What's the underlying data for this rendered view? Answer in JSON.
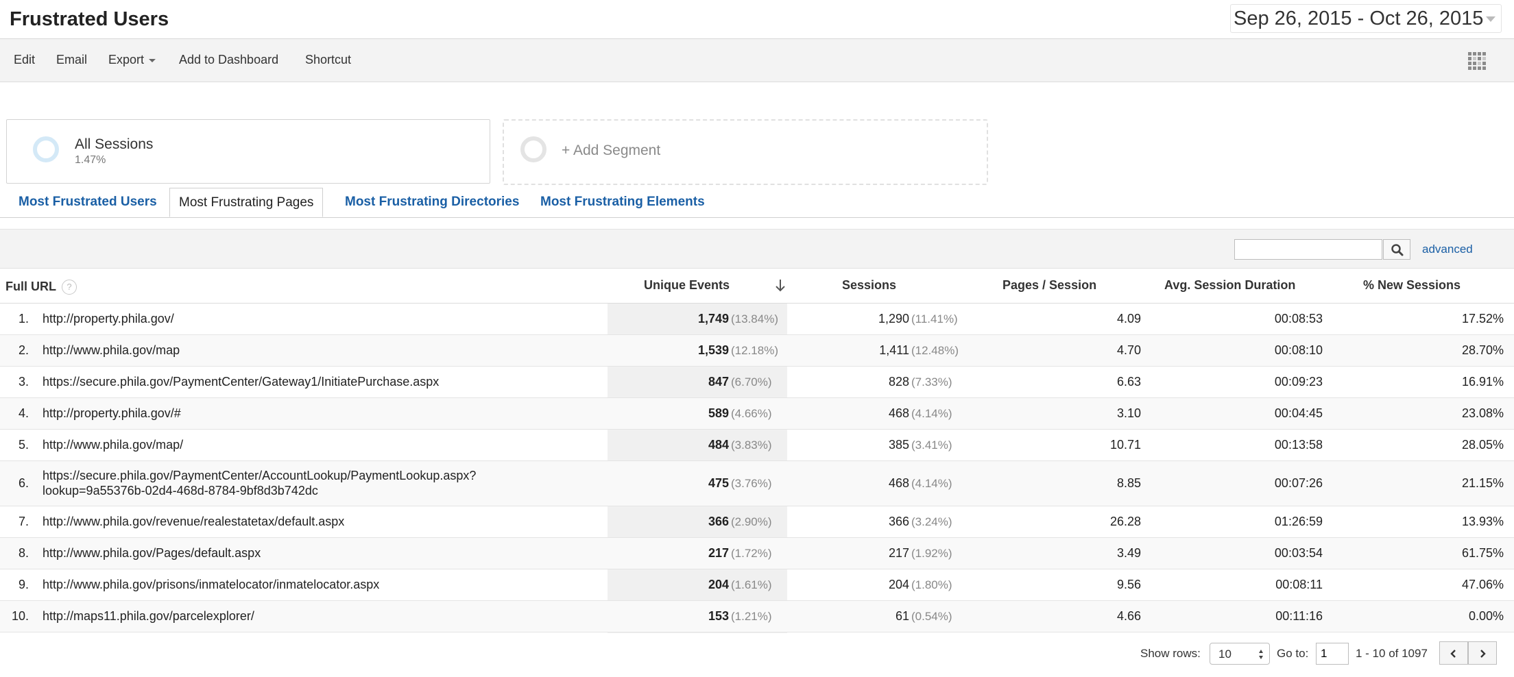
{
  "header": {
    "title": "Frustrated Users",
    "date_range": "Sep 26, 2015 - Oct 26, 2015"
  },
  "toolbar": {
    "edit": "Edit",
    "email": "Email",
    "export": "Export",
    "add_to_dashboard": "Add to Dashboard",
    "shortcut": "Shortcut"
  },
  "segments": {
    "active": {
      "name": "All Sessions",
      "percent": "1.47%",
      "color": "#cfe6f5"
    },
    "add_label": "+ Add Segment"
  },
  "tabs": [
    {
      "label": "Most Frustrated Users",
      "active": false
    },
    {
      "label": "Most Frustrating Pages",
      "active": true
    },
    {
      "label": "Most Frustrating Directories",
      "active": false
    },
    {
      "label": "Most Frustrating Elements",
      "active": false
    }
  ],
  "search": {
    "value": "",
    "advanced_label": "advanced"
  },
  "table": {
    "headers": {
      "url": "Full URL",
      "unique_events": "Unique Events",
      "sessions": "Sessions",
      "pages_per_session": "Pages / Session",
      "avg_duration": "Avg. Session Duration",
      "new_sessions": "% New Sessions"
    },
    "rows": [
      {
        "num": "1.",
        "url": "http://property.phila.gov/",
        "ue": "1,749",
        "ue_pct": "(13.84%)",
        "ses": "1,290",
        "ses_pct": "(11.41%)",
        "pps": "4.09",
        "dur": "00:08:53",
        "new": "17.52%"
      },
      {
        "num": "2.",
        "url": "http://www.phila.gov/map",
        "ue": "1,539",
        "ue_pct": "(12.18%)",
        "ses": "1,411",
        "ses_pct": "(12.48%)",
        "pps": "4.70",
        "dur": "00:08:10",
        "new": "28.70%"
      },
      {
        "num": "3.",
        "url": "https://secure.phila.gov/PaymentCenter/Gateway1/InitiatePurchase.aspx",
        "ue": "847",
        "ue_pct": "(6.70%)",
        "ses": "828",
        "ses_pct": "(7.33%)",
        "pps": "6.63",
        "dur": "00:09:23",
        "new": "16.91%"
      },
      {
        "num": "4.",
        "url": "http://property.phila.gov/#",
        "ue": "589",
        "ue_pct": "(4.66%)",
        "ses": "468",
        "ses_pct": "(4.14%)",
        "pps": "3.10",
        "dur": "00:04:45",
        "new": "23.08%"
      },
      {
        "num": "5.",
        "url": "http://www.phila.gov/map/",
        "ue": "484",
        "ue_pct": "(3.83%)",
        "ses": "385",
        "ses_pct": "(3.41%)",
        "pps": "10.71",
        "dur": "00:13:58",
        "new": "28.05%"
      },
      {
        "num": "6.",
        "url": "https://secure.phila.gov/PaymentCenter/AccountLookup/PaymentLookup.aspx?lookup=9a55376b-02d4-468d-8784-9bf8d3b742dc",
        "ue": "475",
        "ue_pct": "(3.76%)",
        "ses": "468",
        "ses_pct": "(4.14%)",
        "pps": "8.85",
        "dur": "00:07:26",
        "new": "21.15%"
      },
      {
        "num": "7.",
        "url": "http://www.phila.gov/revenue/realestatetax/default.aspx",
        "ue": "366",
        "ue_pct": "(2.90%)",
        "ses": "366",
        "ses_pct": "(3.24%)",
        "pps": "26.28",
        "dur": "01:26:59",
        "new": "13.93%"
      },
      {
        "num": "8.",
        "url": "http://www.phila.gov/Pages/default.aspx",
        "ue": "217",
        "ue_pct": "(1.72%)",
        "ses": "217",
        "ses_pct": "(1.92%)",
        "pps": "3.49",
        "dur": "00:03:54",
        "new": "61.75%"
      },
      {
        "num": "9.",
        "url": "http://www.phila.gov/prisons/inmatelocator/inmatelocator.aspx",
        "ue": "204",
        "ue_pct": "(1.61%)",
        "ses": "204",
        "ses_pct": "(1.80%)",
        "pps": "9.56",
        "dur": "00:08:11",
        "new": "47.06%"
      },
      {
        "num": "10.",
        "url": "http://maps11.phila.gov/parcelexplorer/",
        "ue": "153",
        "ue_pct": "(1.21%)",
        "ses": "61",
        "ses_pct": "(0.54%)",
        "pps": "4.66",
        "dur": "00:11:16",
        "new": "0.00%"
      }
    ]
  },
  "footer": {
    "show_rows_label": "Show rows:",
    "show_rows_value": "10",
    "goto_label": "Go to:",
    "goto_value": "1",
    "range_text": "1 - 10 of 1097"
  }
}
